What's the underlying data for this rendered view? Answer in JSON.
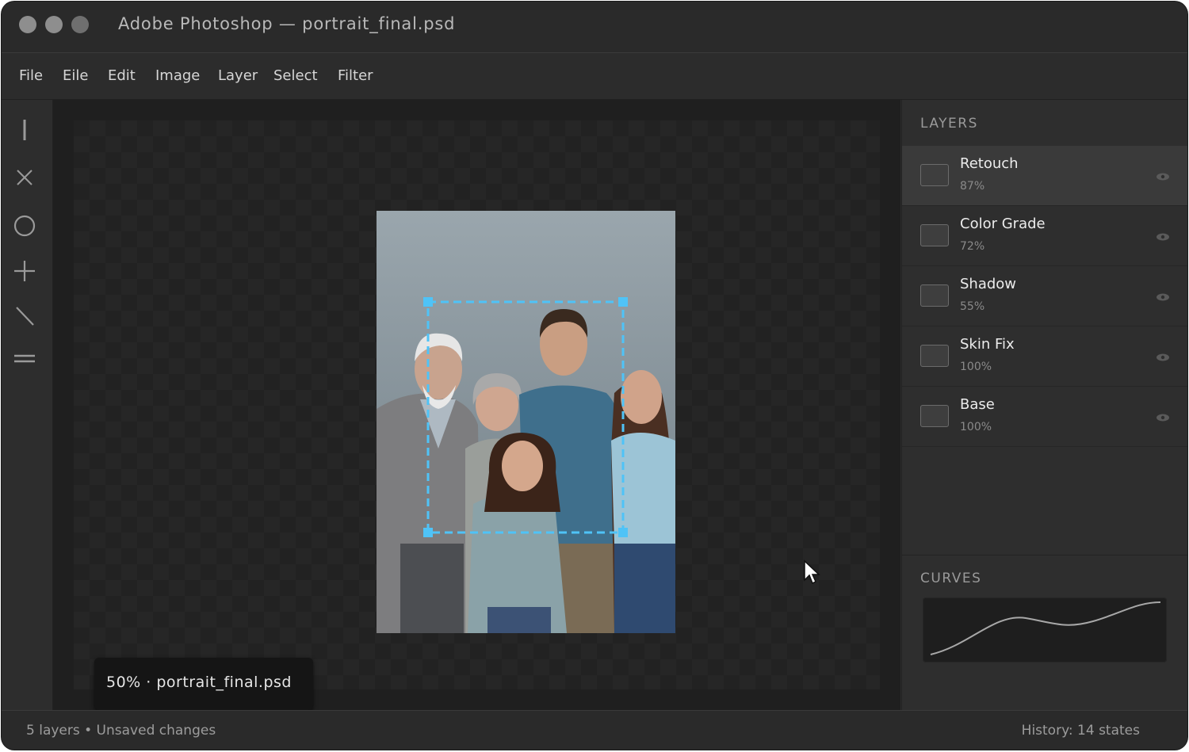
{
  "window": {
    "title": "Adobe Photoshop — portrait_final.psd"
  },
  "menu": [
    "File",
    "Eile",
    "Edit",
    "Image",
    "Layer",
    "Select",
    "Filter"
  ],
  "toolbar": {
    "tools": [
      "vertical-bar-tool-icon",
      "close-x-tool-icon",
      "ellipse-tool-icon",
      "plus-tool-icon",
      "line-tool-icon",
      "equals-tool-icon"
    ]
  },
  "canvas": {
    "zoom_label": "50% · portrait_final.psd",
    "selection_color": "#4fc3f7"
  },
  "layers_panel": {
    "heading": "LAYERS",
    "layers": [
      {
        "name": "Retouch",
        "opacity": "87%",
        "active": true
      },
      {
        "name": "Color Grade",
        "opacity": "72%",
        "active": false
      },
      {
        "name": "Shadow",
        "opacity": "55%",
        "active": false
      },
      {
        "name": "Skin Fix",
        "opacity": "100%",
        "active": false
      },
      {
        "name": "Base",
        "opacity": "100%",
        "active": false
      }
    ]
  },
  "curves_panel": {
    "heading": "CURVES"
  },
  "status": {
    "left": "5 layers • Unsaved changes",
    "right": "History: 14 states"
  }
}
